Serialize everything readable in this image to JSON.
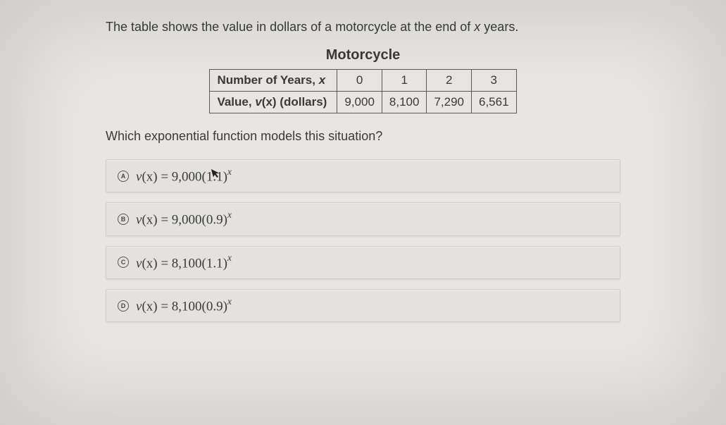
{
  "intro_pre": "The table shows the value in dollars of a motorcycle at the end of ",
  "intro_var": "x",
  "intro_post": " years.",
  "table_title": "Motorcycle",
  "row1_label_pre": "Number of Years, ",
  "row1_label_var": "x",
  "row1_c0": "0",
  "row1_c1": "1",
  "row1_c2": "2",
  "row1_c3": "3",
  "row2_label_pre": "Value, ",
  "row2_label_fn": "v",
  "row2_label_arg": "(x)",
  "row2_label_post": " (dollars)",
  "row2_c0": "9,000",
  "row2_c1": "8,100",
  "row2_c2": "7,290",
  "row2_c3": "6,561",
  "question": "Which exponential function models this situation?",
  "optA_letter": "A",
  "optA_fn": "v",
  "optA_arg": "(x)",
  "optA_eq": " = 9,000(1.1)",
  "optA_exp": "x",
  "optB_letter": "B",
  "optB_fn": "v",
  "optB_arg": "(x)",
  "optB_eq": " = 9,000(0.9)",
  "optB_exp": "x",
  "optC_letter": "C",
  "optC_fn": "v",
  "optC_arg": "(x)",
  "optC_eq": " = 8,100(1.1)",
  "optC_exp": "x",
  "optD_letter": "D",
  "optD_fn": "v",
  "optD_arg": "(x)",
  "optD_eq": " = 8,100(0.9)",
  "optD_exp": "x"
}
